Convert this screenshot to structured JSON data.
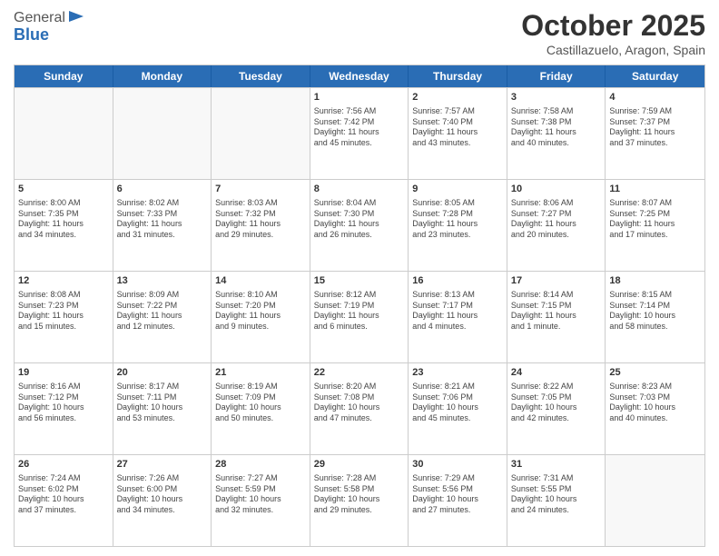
{
  "header": {
    "logo_general": "General",
    "logo_blue": "Blue",
    "month": "October 2025",
    "location": "Castillazuelo, Aragon, Spain"
  },
  "days_of_week": [
    "Sunday",
    "Monday",
    "Tuesday",
    "Wednesday",
    "Thursday",
    "Friday",
    "Saturday"
  ],
  "weeks": [
    [
      {
        "num": "",
        "info": ""
      },
      {
        "num": "",
        "info": ""
      },
      {
        "num": "",
        "info": ""
      },
      {
        "num": "1",
        "info": "Sunrise: 7:56 AM\nSunset: 7:42 PM\nDaylight: 11 hours\nand 45 minutes."
      },
      {
        "num": "2",
        "info": "Sunrise: 7:57 AM\nSunset: 7:40 PM\nDaylight: 11 hours\nand 43 minutes."
      },
      {
        "num": "3",
        "info": "Sunrise: 7:58 AM\nSunset: 7:38 PM\nDaylight: 11 hours\nand 40 minutes."
      },
      {
        "num": "4",
        "info": "Sunrise: 7:59 AM\nSunset: 7:37 PM\nDaylight: 11 hours\nand 37 minutes."
      }
    ],
    [
      {
        "num": "5",
        "info": "Sunrise: 8:00 AM\nSunset: 7:35 PM\nDaylight: 11 hours\nand 34 minutes."
      },
      {
        "num": "6",
        "info": "Sunrise: 8:02 AM\nSunset: 7:33 PM\nDaylight: 11 hours\nand 31 minutes."
      },
      {
        "num": "7",
        "info": "Sunrise: 8:03 AM\nSunset: 7:32 PM\nDaylight: 11 hours\nand 29 minutes."
      },
      {
        "num": "8",
        "info": "Sunrise: 8:04 AM\nSunset: 7:30 PM\nDaylight: 11 hours\nand 26 minutes."
      },
      {
        "num": "9",
        "info": "Sunrise: 8:05 AM\nSunset: 7:28 PM\nDaylight: 11 hours\nand 23 minutes."
      },
      {
        "num": "10",
        "info": "Sunrise: 8:06 AM\nSunset: 7:27 PM\nDaylight: 11 hours\nand 20 minutes."
      },
      {
        "num": "11",
        "info": "Sunrise: 8:07 AM\nSunset: 7:25 PM\nDaylight: 11 hours\nand 17 minutes."
      }
    ],
    [
      {
        "num": "12",
        "info": "Sunrise: 8:08 AM\nSunset: 7:23 PM\nDaylight: 11 hours\nand 15 minutes."
      },
      {
        "num": "13",
        "info": "Sunrise: 8:09 AM\nSunset: 7:22 PM\nDaylight: 11 hours\nand 12 minutes."
      },
      {
        "num": "14",
        "info": "Sunrise: 8:10 AM\nSunset: 7:20 PM\nDaylight: 11 hours\nand 9 minutes."
      },
      {
        "num": "15",
        "info": "Sunrise: 8:12 AM\nSunset: 7:19 PM\nDaylight: 11 hours\nand 6 minutes."
      },
      {
        "num": "16",
        "info": "Sunrise: 8:13 AM\nSunset: 7:17 PM\nDaylight: 11 hours\nand 4 minutes."
      },
      {
        "num": "17",
        "info": "Sunrise: 8:14 AM\nSunset: 7:15 PM\nDaylight: 11 hours\nand 1 minute."
      },
      {
        "num": "18",
        "info": "Sunrise: 8:15 AM\nSunset: 7:14 PM\nDaylight: 10 hours\nand 58 minutes."
      }
    ],
    [
      {
        "num": "19",
        "info": "Sunrise: 8:16 AM\nSunset: 7:12 PM\nDaylight: 10 hours\nand 56 minutes."
      },
      {
        "num": "20",
        "info": "Sunrise: 8:17 AM\nSunset: 7:11 PM\nDaylight: 10 hours\nand 53 minutes."
      },
      {
        "num": "21",
        "info": "Sunrise: 8:19 AM\nSunset: 7:09 PM\nDaylight: 10 hours\nand 50 minutes."
      },
      {
        "num": "22",
        "info": "Sunrise: 8:20 AM\nSunset: 7:08 PM\nDaylight: 10 hours\nand 47 minutes."
      },
      {
        "num": "23",
        "info": "Sunrise: 8:21 AM\nSunset: 7:06 PM\nDaylight: 10 hours\nand 45 minutes."
      },
      {
        "num": "24",
        "info": "Sunrise: 8:22 AM\nSunset: 7:05 PM\nDaylight: 10 hours\nand 42 minutes."
      },
      {
        "num": "25",
        "info": "Sunrise: 8:23 AM\nSunset: 7:03 PM\nDaylight: 10 hours\nand 40 minutes."
      }
    ],
    [
      {
        "num": "26",
        "info": "Sunrise: 7:24 AM\nSunset: 6:02 PM\nDaylight: 10 hours\nand 37 minutes."
      },
      {
        "num": "27",
        "info": "Sunrise: 7:26 AM\nSunset: 6:00 PM\nDaylight: 10 hours\nand 34 minutes."
      },
      {
        "num": "28",
        "info": "Sunrise: 7:27 AM\nSunset: 5:59 PM\nDaylight: 10 hours\nand 32 minutes."
      },
      {
        "num": "29",
        "info": "Sunrise: 7:28 AM\nSunset: 5:58 PM\nDaylight: 10 hours\nand 29 minutes."
      },
      {
        "num": "30",
        "info": "Sunrise: 7:29 AM\nSunset: 5:56 PM\nDaylight: 10 hours\nand 27 minutes."
      },
      {
        "num": "31",
        "info": "Sunrise: 7:31 AM\nSunset: 5:55 PM\nDaylight: 10 hours\nand 24 minutes."
      },
      {
        "num": "",
        "info": ""
      }
    ]
  ]
}
